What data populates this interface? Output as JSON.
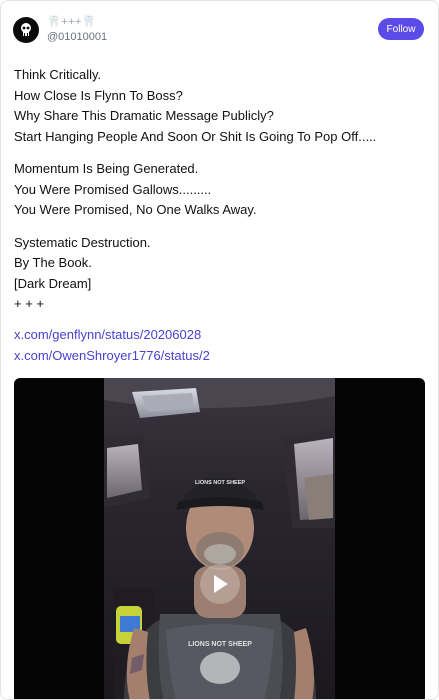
{
  "post": {
    "display_name": "🦷+++🦷",
    "handle": "@01010001",
    "follow_label": "Follow",
    "body": [
      [
        "Think Critically.",
        "How Close Is Flynn To Boss?",
        "Why Share This Dramatic Message Publicly?",
        "Start Hanging People And Soon Or Shit Is Going To Pop Off....."
      ],
      [
        "Momentum Is Being Generated.",
        "You Were Promised Gallows.........",
        "You Were Promised, No One Walks Away."
      ],
      [
        "Systematic Destruction.",
        "By The Book.",
        "[Dark Dream]",
        "+ + +"
      ]
    ],
    "links": [
      "x.com/genflynn/status/20206028",
      "x.com/OwenShroyer1776/status/2"
    ]
  },
  "video": {
    "shirt_text": "LIONS NOT SHEEP",
    "cap_text": "LIONS NOT SHEEP"
  },
  "colors": {
    "accent": "#5b4be8",
    "link": "#4b3fd1",
    "text": "#111111",
    "muted": "#6b7280"
  },
  "icons": {
    "avatar": "skull-icon",
    "play": "play-icon"
  }
}
